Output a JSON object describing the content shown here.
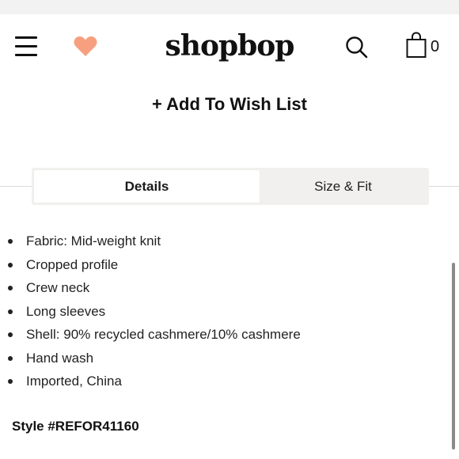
{
  "header": {
    "logo": "shopbop",
    "cart_count": "0",
    "icons": [
      "hamburger-menu-icon",
      "heart-icon",
      "search-icon",
      "shopping-bag-icon"
    ],
    "heart_color": "#f7a07f"
  },
  "product": {
    "wishlist_label": "+ Add To Wish List"
  },
  "tabs": [
    {
      "label": "Details",
      "active": true
    },
    {
      "label": "Size & Fit",
      "active": false
    }
  ],
  "details": {
    "items": [
      "Fabric: Mid-weight knit",
      "Cropped profile",
      "Crew neck",
      "Long sleeves",
      "Shell: 90% recycled cashmere/10% cashmere",
      "Hand wash",
      "Imported, China"
    ],
    "style": "Style #REFOR41160"
  }
}
